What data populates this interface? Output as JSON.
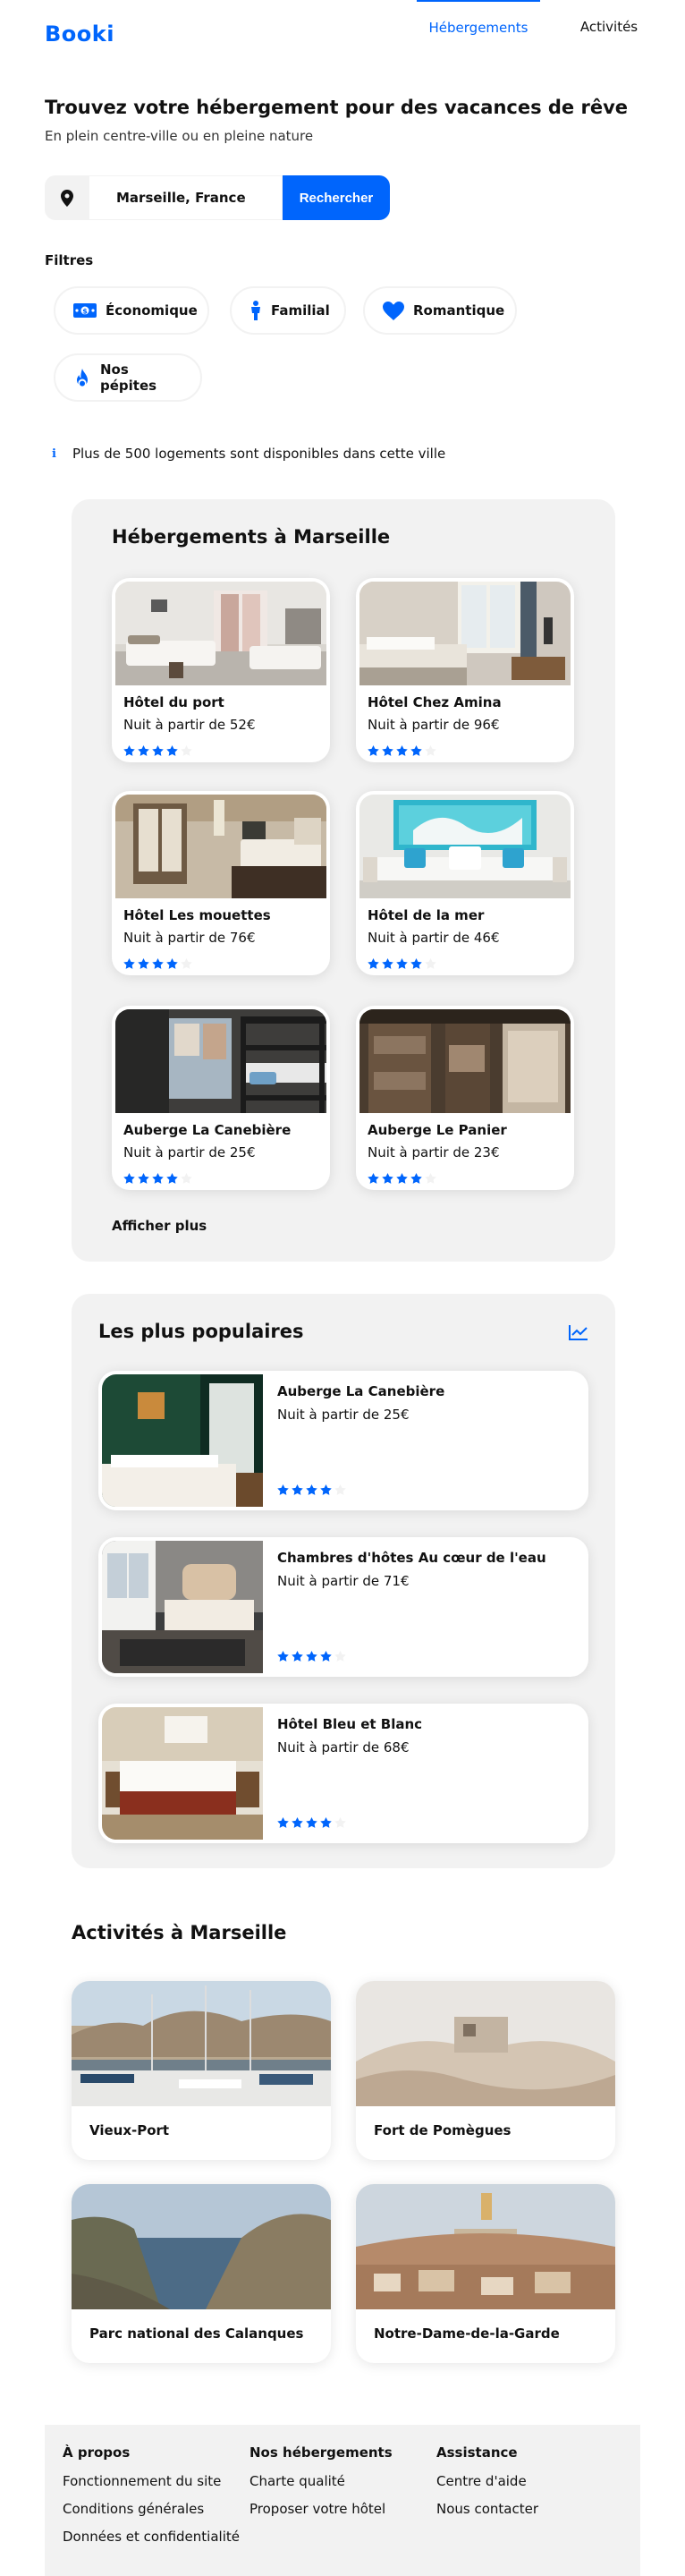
{
  "header": {
    "logo": "Booki",
    "nav": [
      {
        "label": "Hébergements",
        "active": true
      },
      {
        "label": "Activités",
        "active": false
      }
    ]
  },
  "hero": {
    "title": "Trouvez votre hébergement pour des vacances de rêve",
    "subtitle": "En plein centre-ville ou en pleine nature"
  },
  "search": {
    "icon": "location-pin-icon",
    "value": "Marseille, France",
    "button": "Rechercher"
  },
  "filters": {
    "label": "Filtres",
    "items": [
      {
        "label": "Économique",
        "icon": "money-icon"
      },
      {
        "label": "Familial",
        "icon": "child-icon"
      },
      {
        "label": "Romantique",
        "icon": "heart-icon"
      },
      {
        "label": "Nos pépites",
        "icon": "fire-icon"
      }
    ]
  },
  "info": {
    "icon": "info-icon",
    "text": "Plus de 500 logements sont disponibles dans cette ville"
  },
  "lodgings": {
    "title": "Hébergements à Marseille",
    "more": "Afficher plus",
    "items": [
      {
        "name": "Hôtel du port",
        "price": "Nuit à partir de 52€",
        "rating": 4
      },
      {
        "name": "Hôtel Chez Amina",
        "price": "Nuit à partir de 96€",
        "rating": 4
      },
      {
        "name": "Hôtel Les mouettes",
        "price": "Nuit à partir de 76€",
        "rating": 4
      },
      {
        "name": "Hôtel de la mer",
        "price": "Nuit à partir de 46€",
        "rating": 4
      },
      {
        "name": "Auberge La Canebière",
        "price": "Nuit à partir de 25€",
        "rating": 4
      },
      {
        "name": "Auberge Le Panier",
        "price": "Nuit à partir de 23€",
        "rating": 4
      }
    ]
  },
  "popular": {
    "title": "Les plus populaires",
    "icon": "trend-chart-icon",
    "items": [
      {
        "name": "Auberge La Canebière",
        "price": "Nuit à partir de 25€",
        "rating": 4
      },
      {
        "name": "Chambres d'hôtes Au cœur de l'eau",
        "price": "Nuit à partir de 71€",
        "rating": 4
      },
      {
        "name": "Hôtel Bleu et Blanc",
        "price": "Nuit à partir de 68€",
        "rating": 4
      }
    ]
  },
  "activities": {
    "title": "Activités à Marseille",
    "items": [
      {
        "name": "Vieux-Port"
      },
      {
        "name": "Fort de Pomègues"
      },
      {
        "name": "Parc national des Calanques"
      },
      {
        "name": "Notre-Dame-de-la-Garde"
      }
    ]
  },
  "footer": {
    "columns": [
      {
        "title": "À propos",
        "links": [
          "Fonctionnement du site",
          "Conditions générales",
          "Données et confidentialité"
        ]
      },
      {
        "title": "Nos hébergements",
        "links": [
          "Charte qualité",
          "Proposer votre hôtel"
        ]
      },
      {
        "title": "Assistance",
        "links": [
          "Centre d'aide",
          "Nous contacter"
        ]
      }
    ]
  },
  "colors": {
    "accent": "#0065fc",
    "panel": "#f2f2f2",
    "star_off": "#f2f2f2"
  }
}
